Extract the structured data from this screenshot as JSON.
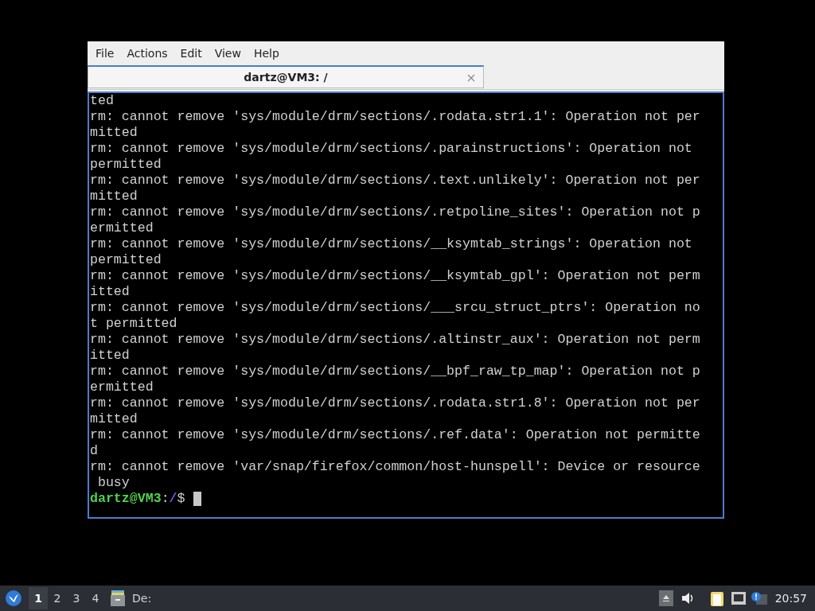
{
  "window": {
    "menu": [
      "File",
      "Actions",
      "Edit",
      "View",
      "Help"
    ],
    "tabs": [
      {
        "title": "dartz@VM3: /",
        "selected": true
      }
    ]
  },
  "terminal": {
    "lines": [
      "ted",
      "rm: cannot remove 'sys/module/drm/sections/.rodata.str1.1': Operation not per",
      "mitted",
      "rm: cannot remove 'sys/module/drm/sections/.parainstructions': Operation not",
      "permitted",
      "rm: cannot remove 'sys/module/drm/sections/.text.unlikely': Operation not per",
      "mitted",
      "rm: cannot remove 'sys/module/drm/sections/.retpoline_sites': Operation not p",
      "ermitted",
      "rm: cannot remove 'sys/module/drm/sections/__ksymtab_strings': Operation not",
      "permitted",
      "rm: cannot remove 'sys/module/drm/sections/__ksymtab_gpl': Operation not perm",
      "itted",
      "rm: cannot remove 'sys/module/drm/sections/___srcu_struct_ptrs': Operation no",
      "t permitted",
      "rm: cannot remove 'sys/module/drm/sections/.altinstr_aux': Operation not perm",
      "itted",
      "rm: cannot remove 'sys/module/drm/sections/__bpf_raw_tp_map': Operation not p",
      "ermitted",
      "rm: cannot remove 'sys/module/drm/sections/.rodata.str1.8': Operation not per",
      "mitted",
      "rm: cannot remove 'sys/module/drm/sections/.ref.data': Operation not permitte",
      "d",
      "rm: cannot remove 'var/snap/firefox/common/host-hunspell': Device or resource",
      " busy"
    ],
    "prompt": {
      "user_host": "dartz@VM3",
      "colon": ":",
      "path": "/",
      "symbol": "$"
    }
  },
  "taskbar": {
    "workspaces": [
      {
        "label": "1",
        "selected": true
      },
      {
        "label": "2",
        "selected": false
      },
      {
        "label": "3",
        "selected": false
      },
      {
        "label": "4",
        "selected": false
      }
    ],
    "task": "De:",
    "clock": "20:57"
  }
}
